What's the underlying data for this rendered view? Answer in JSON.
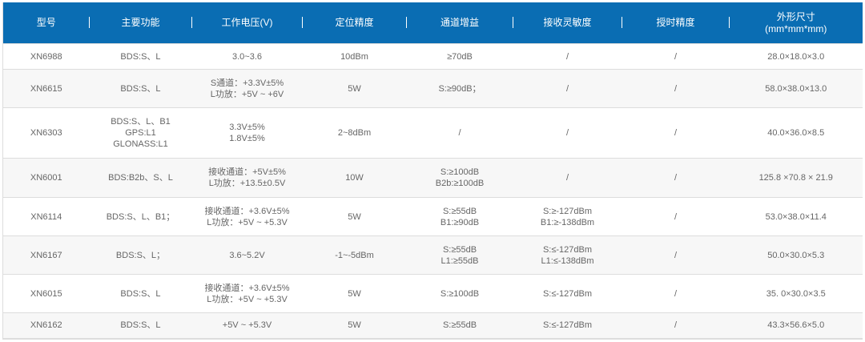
{
  "headers": [
    "型号",
    "主要功能",
    "工作电压(V)",
    "定位精度",
    "通道增益",
    "接收灵敏度",
    "授时精度",
    "外形尺寸",
    "(mm*mm*mm)"
  ],
  "rows": [
    {
      "model": "XN6988",
      "func": [
        "BDS:S、L"
      ],
      "volt": [
        "3.0~3.6"
      ],
      "acc": "10dBm",
      "gain": [
        "≥70dB"
      ],
      "sens": [
        "/"
      ],
      "timing": "/",
      "size": "28.0×18.0×3.0"
    },
    {
      "model": "XN6615",
      "func": [
        "BDS:S、L"
      ],
      "volt": [
        "S通道：+3.3V±5%",
        "L功放：+5V ~ +6V"
      ],
      "acc": "5W",
      "gain": [
        "S:≥90dB；"
      ],
      "sens": [
        "/"
      ],
      "timing": "/",
      "size": "58.0×38.0×13.0"
    },
    {
      "model": "XN6303",
      "func": [
        "BDS:S、L、B1",
        "GPS:L1",
        "GLONASS:L1"
      ],
      "volt": [
        "3.3V±5%",
        "1.8V±5%"
      ],
      "acc": "2~8dBm",
      "gain": [
        "/"
      ],
      "sens": [
        "/"
      ],
      "timing": "/",
      "size": "40.0×36.0×8.5"
    },
    {
      "model": "XN6001",
      "func": [
        "BDS:B2b、S、L"
      ],
      "volt": [
        "接收通道：+5V±5%",
        "L功放：+13.5±0.5V"
      ],
      "acc": "10W",
      "gain": [
        "S:≥100dB",
        "B2b:≥100dB"
      ],
      "sens": [
        "/"
      ],
      "timing": "/",
      "size": "125.8 ×70.8 × 21.9"
    },
    {
      "model": "XN6114",
      "func": [
        "BDS:S、L、B1；"
      ],
      "volt": [
        "接收通道：+3.6V±5%",
        "L功放：+5V ~ +5.3V"
      ],
      "acc": "5W",
      "gain": [
        "S:≥55dB",
        "B1:≥90dB"
      ],
      "sens": [
        "S:≥-127dBm",
        "B1:≥-138dBm"
      ],
      "timing": "/",
      "size": "53.0×38.0×11.4"
    },
    {
      "model": "XN6167",
      "func": [
        "BDS:S、L；"
      ],
      "volt": [
        "3.6~5.2V"
      ],
      "acc": "-1~-5dBm",
      "gain": [
        "S:≥55dB",
        "L1:≥55dB"
      ],
      "sens": [
        "S:≤-127dBm",
        "L1:≤-138dBm"
      ],
      "timing": "/",
      "size": "50.0×30.0×5.3"
    },
    {
      "model": "XN6015",
      "func": [
        "BDS:S、L"
      ],
      "volt": [
        "接收通道：+3.6V±5%",
        "L功放：+5V ~ +5.3V"
      ],
      "acc": "5W",
      "gain": [
        "S:≥100dB"
      ],
      "sens": [
        "S:≤-127dBm"
      ],
      "timing": "/",
      "size": "35. 0×30.0×3.5"
    },
    {
      "model": "XN6162",
      "func": [
        "BDS:S、L"
      ],
      "volt": [
        "+5V ~ +5.3V"
      ],
      "acc": "5W",
      "gain": [
        "S:≥55dB"
      ],
      "sens": [
        "S:≤-127dBm"
      ],
      "timing": "/",
      "size": "43.3×56.6×5.0"
    }
  ]
}
